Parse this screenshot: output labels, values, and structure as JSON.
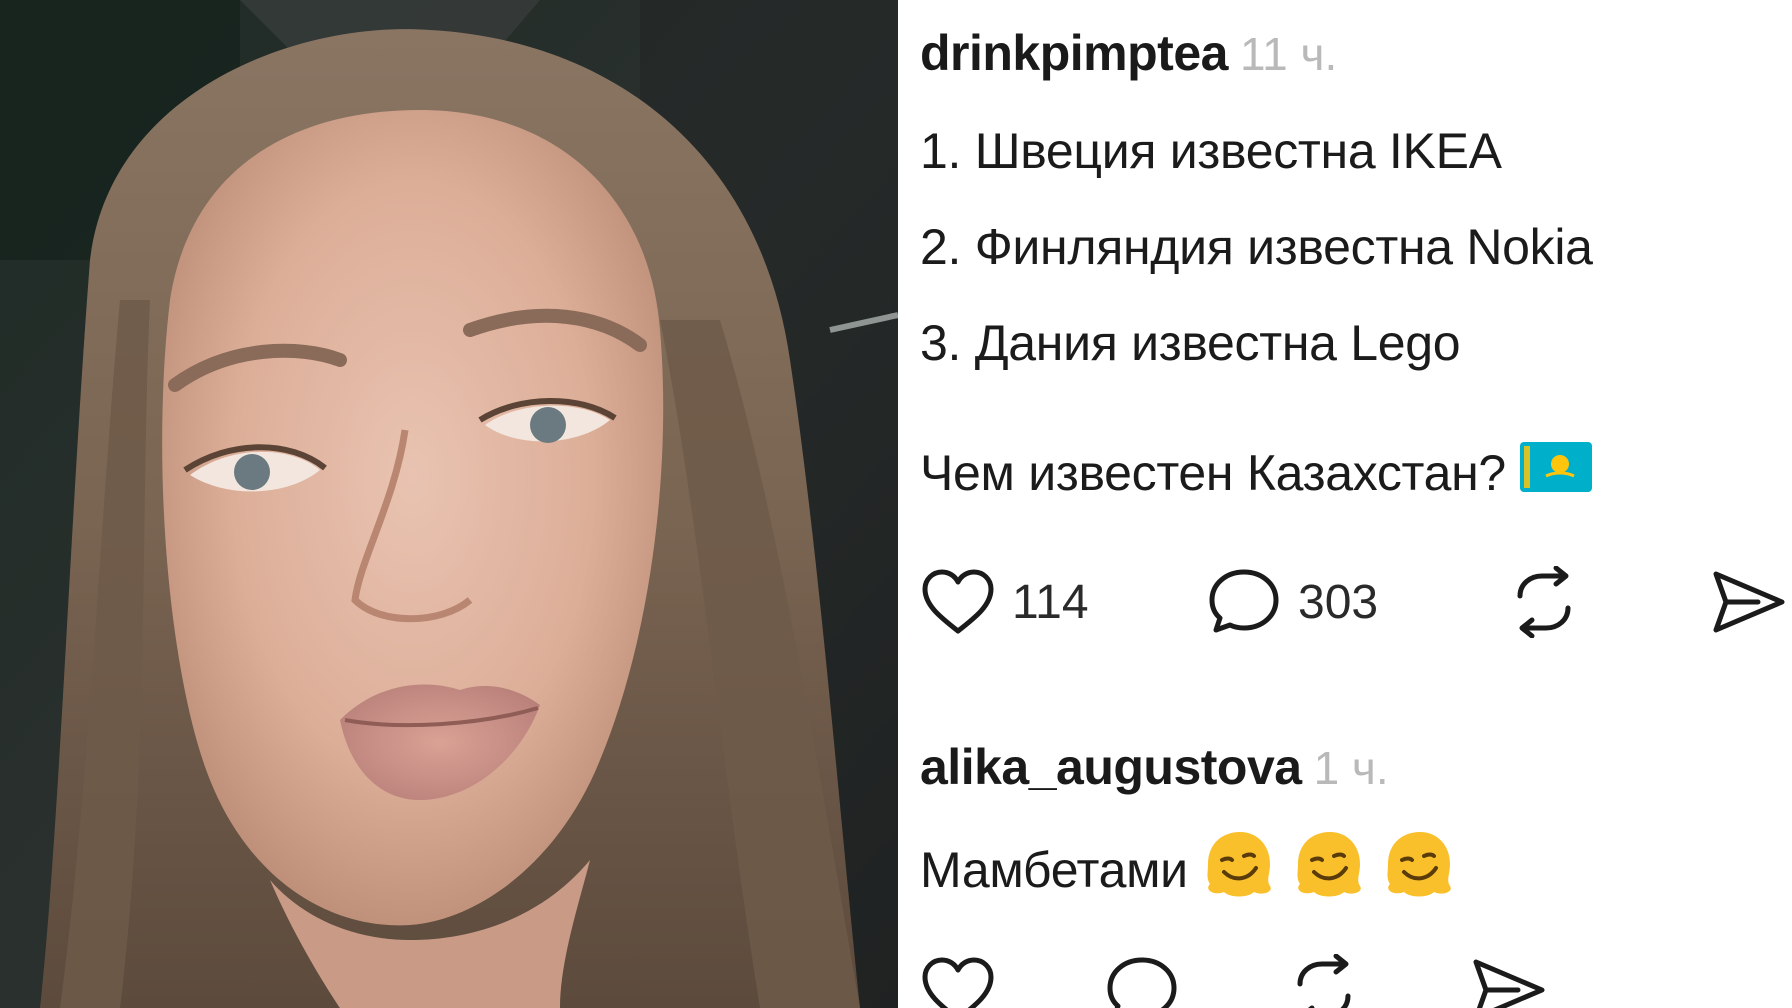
{
  "post": {
    "username": "drinkpimptea",
    "time": "11 ч.",
    "lines": [
      "1. Швеция известна IKEA",
      "2. Финляндия известна Nokia",
      "3. Дания известна Lego",
      "Чем известен Казахстан?"
    ],
    "flag_icon": "kazakhstan-flag-icon",
    "likes": "114",
    "comments": "303",
    "accent_flag": "#00afca",
    "accent_sun": "#fec50c"
  },
  "reply": {
    "username": "alika_augustova",
    "time": "1 ч.",
    "text": "Мамбетами",
    "emoji_icon": "melting-face-emoji-icon"
  },
  "icons": {
    "like": "heart-icon",
    "comment": "speech-bubble-icon",
    "repost": "repost-icon",
    "share": "send-icon"
  }
}
